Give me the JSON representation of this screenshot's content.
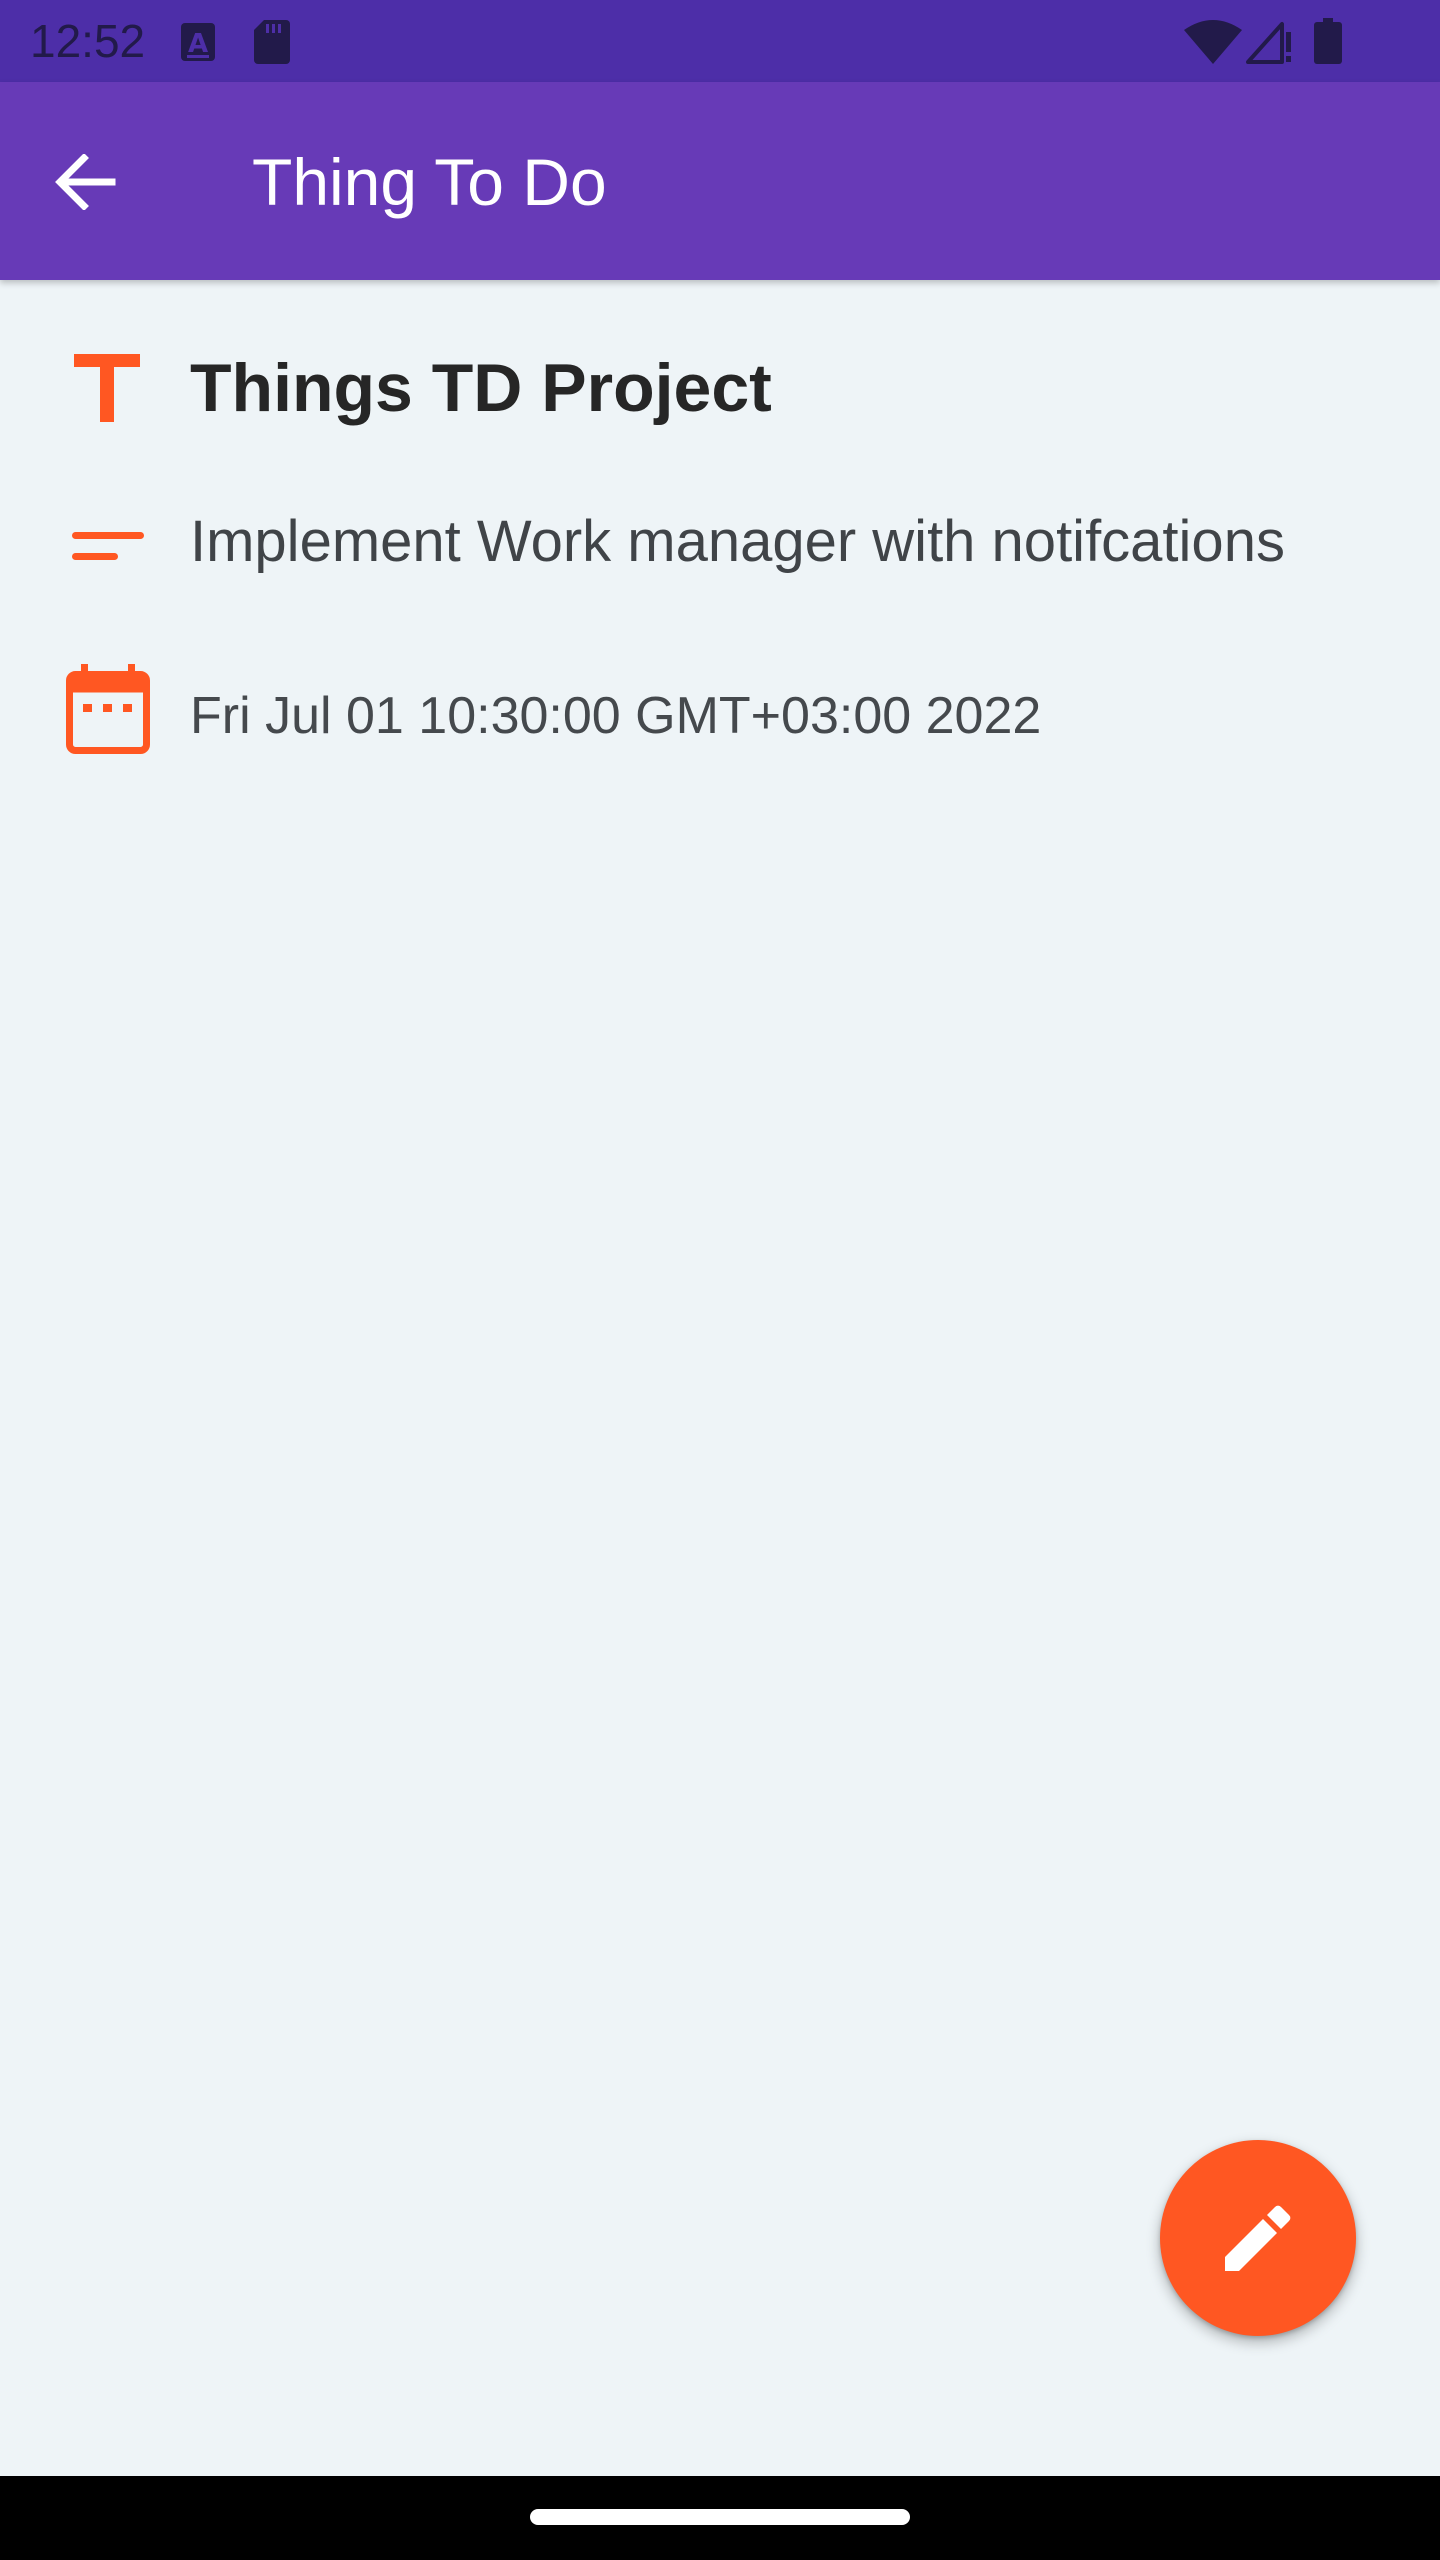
{
  "status_bar": {
    "time": "12:52",
    "icons": [
      "keyboard-a-icon",
      "sd-card-icon",
      "wifi-icon",
      "cellular-signal-icon",
      "battery-icon"
    ]
  },
  "app_bar": {
    "title": "Thing To Do",
    "back_icon": "arrow-back-icon",
    "background_color": "#673ab7"
  },
  "detail": {
    "title": "Things TD Project",
    "title_icon": "title-t-icon",
    "description": "Implement Work manager with notifcations",
    "description_icon": "short-text-icon",
    "date": "Fri Jul 01 10:30:00 GMT+03:00 2022",
    "date_icon": "calendar-icon"
  },
  "fab": {
    "icon": "edit-pencil-icon",
    "color": "#ff5722"
  },
  "colors": {
    "accent": "#ff5722",
    "status_bar": "#4d2ea8",
    "background": "#eef4f7"
  }
}
